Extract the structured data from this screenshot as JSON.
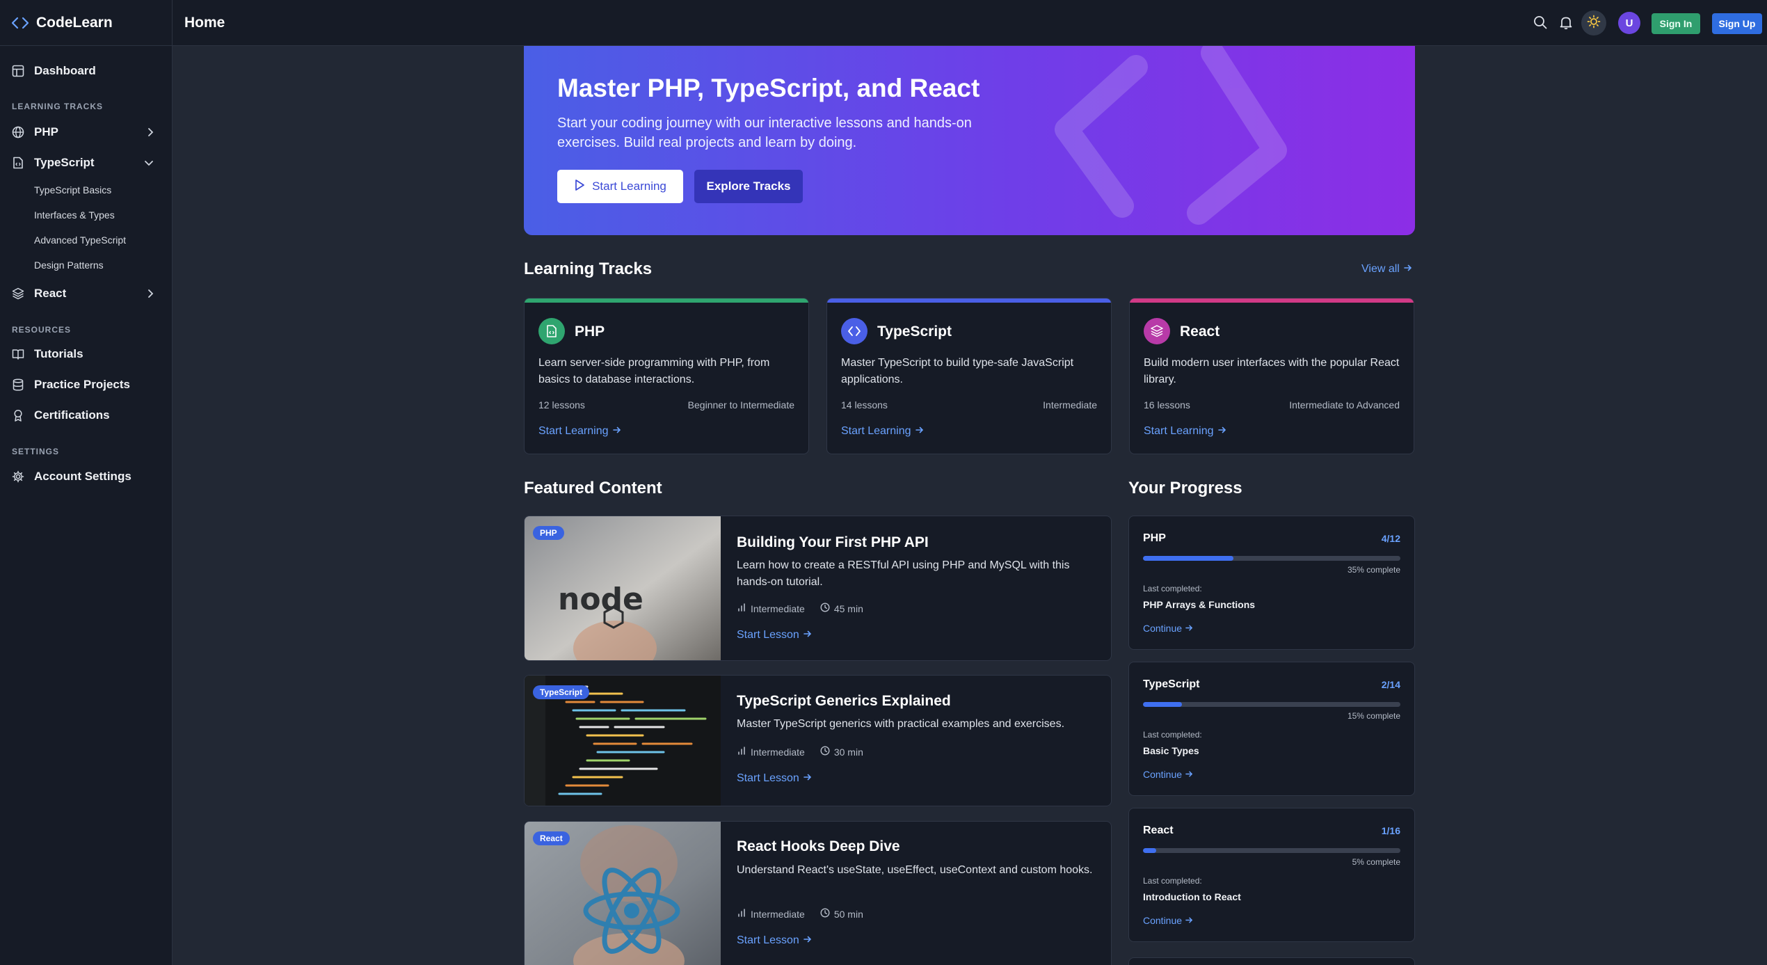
{
  "brand": {
    "name": "CodeLearn"
  },
  "header": {
    "title": "Home",
    "avatar_initial": "U",
    "sign_in": "Sign In",
    "sign_up": "Sign Up"
  },
  "sidebar": {
    "dashboard": "Dashboard",
    "sections": {
      "learning": "LEARNING TRACKS",
      "resources": "RESOURCES",
      "settings": "SETTINGS"
    },
    "tracks": {
      "php": "PHP",
      "typescript": "TypeScript",
      "react": "React"
    },
    "typescript_sub": [
      "TypeScript Basics",
      "Interfaces & Types",
      "Advanced TypeScript",
      "Design Patterns"
    ],
    "resources": [
      "Tutorials",
      "Practice Projects",
      "Certifications"
    ],
    "account": "Account Settings"
  },
  "hero": {
    "title": "Master PHP, TypeScript, and React",
    "description": "Start your coding journey with our interactive lessons and hands-on exercises. Build real projects and learn by doing.",
    "primary": "Start Learning",
    "secondary": "Explore Tracks"
  },
  "tracks_section": {
    "title": "Learning Tracks",
    "view_all": "View all"
  },
  "tracks": [
    {
      "name": "PHP",
      "description": "Learn server-side programming with PHP, from basics to database interactions.",
      "lessons": "12 lessons",
      "level": "Beginner to Intermediate",
      "link": "Start Learning",
      "color": "#2fa56f"
    },
    {
      "name": "TypeScript",
      "description": "Master TypeScript to build type-safe JavaScript applications.",
      "lessons": "14 lessons",
      "level": "Intermediate",
      "link": "Start Learning",
      "color": "#4a5fe6"
    },
    {
      "name": "React",
      "description": "Build modern user interfaces with the popular React library.",
      "lessons": "16 lessons",
      "level": "Intermediate to Advanced",
      "link": "Start Learning",
      "color": "#d13a86"
    }
  ],
  "featured": {
    "title": "Featured Content",
    "items": [
      {
        "tag": "PHP",
        "title": "Building Your First PHP API",
        "description": "Learn how to create a RESTful API using PHP and MySQL with this hands-on tutorial.",
        "level": "Intermediate",
        "duration": "45 min",
        "link": "Start Lesson"
      },
      {
        "tag": "TypeScript",
        "title": "TypeScript Generics Explained",
        "description": "Master TypeScript generics with practical examples and exercises.",
        "level": "Intermediate",
        "duration": "30 min",
        "link": "Start Lesson"
      },
      {
        "tag": "React",
        "title": "React Hooks Deep Dive",
        "description": "Understand React's useState, useEffect, useContext and custom hooks.",
        "level": "Intermediate",
        "duration": "50 min",
        "link": "Start Lesson"
      }
    ]
  },
  "progress": {
    "title": "Your Progress",
    "items": [
      {
        "name": "PHP",
        "count": "4/12",
        "percent": 35,
        "percent_text": "35% complete",
        "last_label": "Last completed:",
        "last": "PHP Arrays & Functions",
        "link": "Continue"
      },
      {
        "name": "TypeScript",
        "count": "2/14",
        "percent": 15,
        "percent_text": "15% complete",
        "last_label": "Last completed:",
        "last": "Basic Types",
        "link": "Continue"
      },
      {
        "name": "React",
        "count": "1/16",
        "percent": 5,
        "percent_text": "5% complete",
        "last_label": "Last completed:",
        "last": "Introduction to React",
        "link": "Continue"
      }
    ]
  }
}
